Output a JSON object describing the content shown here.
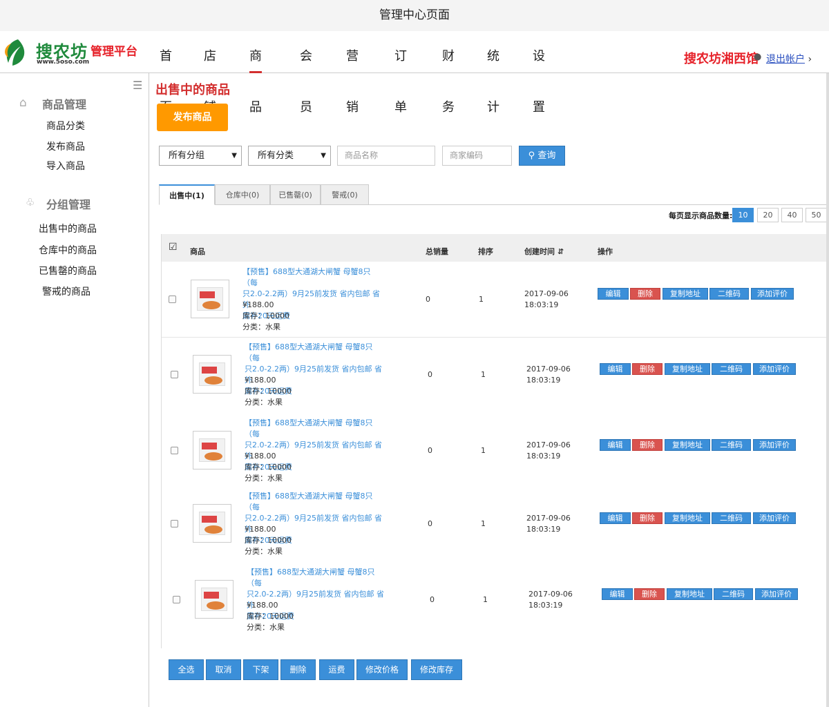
{
  "window": {
    "title": "管理中心页面"
  },
  "header": {
    "logo_text": "搜农坊",
    "logo_url": "www.5oso.com",
    "platform": "管理平台",
    "nav": [
      "首页",
      "店铺",
      "商品",
      "会员",
      "营销",
      "订单",
      "财务",
      "统计",
      "设置"
    ],
    "active_nav": "商品",
    "shop_name": "搜农坊湘西馆",
    "logout": "退出帐户"
  },
  "sidebar": {
    "groups": [
      {
        "title": "商品管理",
        "icon": "home-icon",
        "items": [
          "商品分类",
          "发布商品",
          "导入商品"
        ]
      },
      {
        "title": "分组管理",
        "icon": "basket-icon",
        "items": [
          "出售中的商品",
          "仓库中的商品",
          "已售罄的商品",
          "警戒的商品"
        ]
      }
    ]
  },
  "main": {
    "title": "出售中的商品",
    "publish_button": "发布商品",
    "filters": {
      "group_select": "所有分组",
      "category_select": "所有分类",
      "name_placeholder": "商品名称",
      "code_placeholder": "商家编码",
      "search_button": "查询"
    },
    "tabs": [
      "出售中(1)",
      "仓库中(0)",
      "已售罄(0)",
      "警戒(0)"
    ],
    "page_size_label": "每页显示商品数量:",
    "page_sizes": [
      "10",
      "20",
      "40",
      "50"
    ],
    "active_page_size": "10",
    "table": {
      "headers": [
        "商品",
        "总销量",
        "排序",
        "创建时间",
        "操作"
      ],
      "rows": [
        {
          "name_lines": [
            "【预售】688型大通湖大闸蟹 母蟹8只（每",
            "只2.0-2.2两）9月25前发货 省内包邮 省外",
            "需补20元运费"
          ],
          "price": "¥188.00",
          "stock": "库存：10000",
          "category": "分类：水果",
          "sales": "0",
          "sort": "1",
          "date": "2017-09-06",
          "time": "18:03:19"
        },
        {
          "name_lines": [
            "【预售】688型大通湖大闸蟹 母蟹8只（每",
            "只2.0-2.2两）9月25前发货 省内包邮 省外",
            "需补20元运费"
          ],
          "price": "¥188.00",
          "stock": "库存：10000",
          "category": "分类：水果",
          "sales": "0",
          "sort": "1",
          "date": "2017-09-06",
          "time": "18:03:19"
        },
        {
          "name_lines": [
            "【预售】688型大通湖大闸蟹 母蟹8只（每",
            "只2.0-2.2两）9月25前发货 省内包邮 省外",
            "需补20元运费"
          ],
          "price": "¥188.00",
          "stock": "库存：10000",
          "category": "分类：水果",
          "sales": "0",
          "sort": "1",
          "date": "2017-09-06",
          "time": "18:03:19"
        },
        {
          "name_lines": [
            "【预售】688型大通湖大闸蟹 母蟹8只（每",
            "只2.0-2.2两）9月25前发货 省内包邮 省外",
            "需补20元运费"
          ],
          "price": "¥188.00",
          "stock": "库存：10000",
          "category": "分类：水果",
          "sales": "0",
          "sort": "1",
          "date": "2017-09-06",
          "time": "18:03:19"
        },
        {
          "name_lines": [
            "【预售】688型大通湖大闸蟹 母蟹8只（每",
            "只2.0-2.2两）9月25前发货 省内包邮 省外",
            "需补20元运费"
          ],
          "price": "¥188.00",
          "stock": "库存：10000",
          "category": "分类：水果",
          "sales": "0",
          "sort": "1",
          "date": "2017-09-06",
          "time": "18:03:19"
        }
      ],
      "row_actions": [
        "编辑",
        "删除",
        "复制地址",
        "二维码",
        "添加评价"
      ]
    },
    "bulk_actions": [
      "全选",
      "取消",
      "下架",
      "删除",
      "运费",
      "修改价格",
      "修改库存"
    ]
  },
  "colors": {
    "brand_red": "#d32f2f",
    "accent_blue": "#3b8fd9",
    "publish_orange": "#ff9900",
    "logo_green": "#1f8a3c"
  }
}
